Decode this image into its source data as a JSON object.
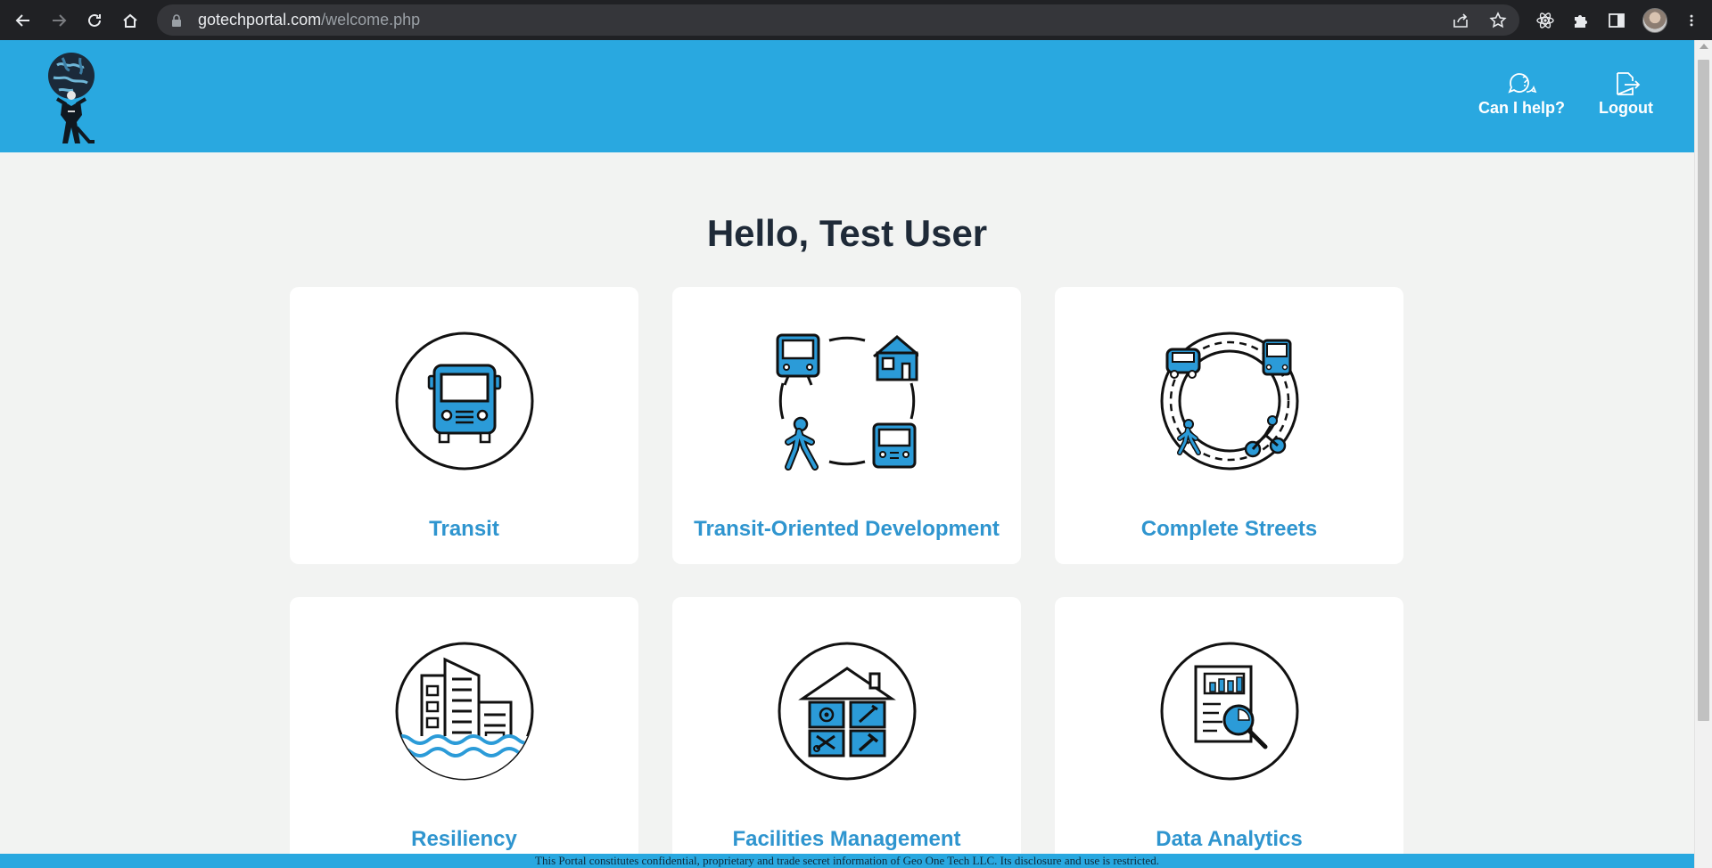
{
  "browser": {
    "url_host": "gotechportal.com",
    "url_path": "/welcome.php"
  },
  "header": {
    "help_label": "Can I help?",
    "logout_label": "Logout"
  },
  "main": {
    "greeting": "Hello, Test User",
    "cards": [
      {
        "label": "Transit",
        "icon": "bus-icon"
      },
      {
        "label": "Transit-Oriented Development",
        "icon": "transit-oriented-development-icon"
      },
      {
        "label": "Complete Streets",
        "icon": "complete-streets-icon"
      },
      {
        "label": "Resiliency",
        "icon": "flooded-city-icon"
      },
      {
        "label": "Facilities Management",
        "icon": "facilities-house-icon"
      },
      {
        "label": "Data Analytics",
        "icon": "report-magnifier-icon"
      }
    ]
  },
  "footer": {
    "text": "This Portal constitutes confidential, proprietary and trade secret information of Geo One Tech LLC. Its disclosure and use is restricted."
  },
  "colors": {
    "brand_blue": "#29a8e0",
    "label_blue": "#2f95cf",
    "page_bg": "#f2f3f2",
    "greeting_text": "#1f2a38"
  }
}
